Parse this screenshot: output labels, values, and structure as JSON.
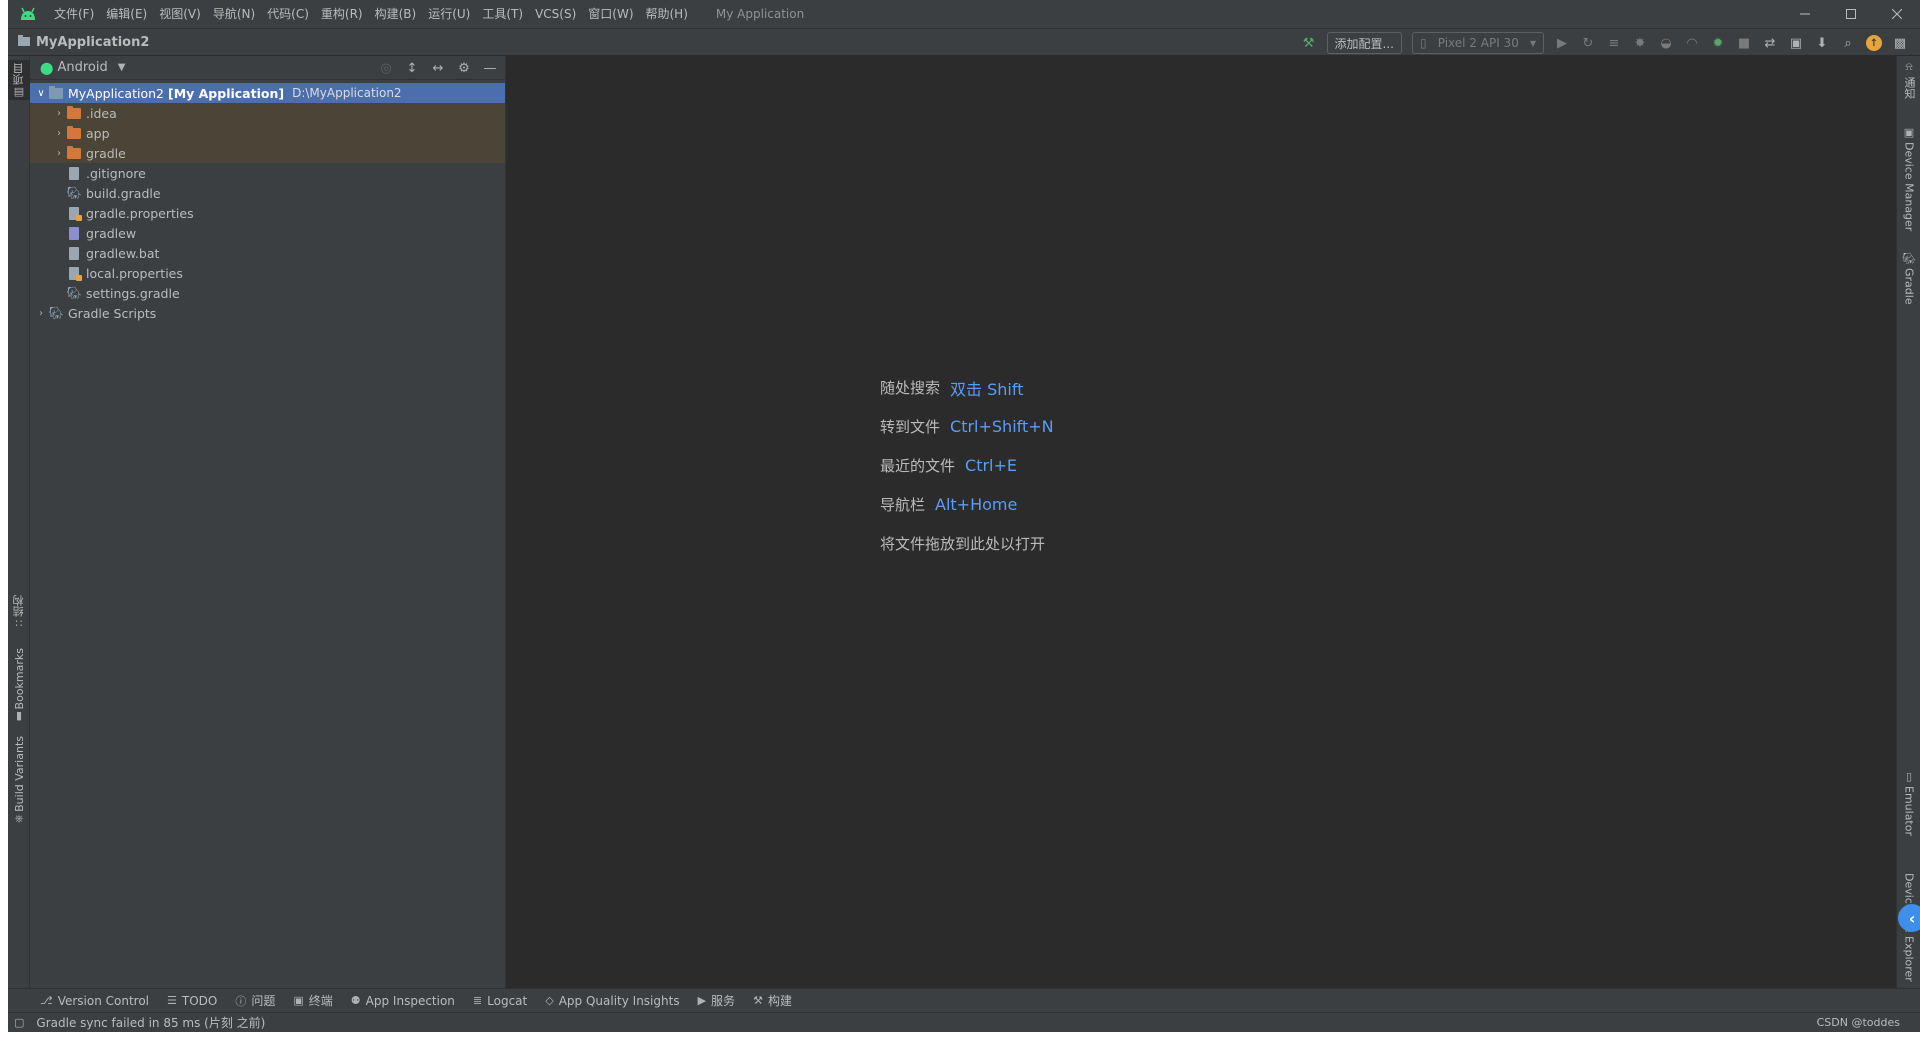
{
  "titlebar": {
    "menus": [
      "文件(F)",
      "编辑(E)",
      "视图(V)",
      "导航(N)",
      "代码(C)",
      "重构(R)",
      "构建(B)",
      "运行(U)",
      "工具(T)",
      "VCS(S)",
      "窗口(W)",
      "帮助(H)"
    ],
    "app_title": "My Application"
  },
  "navbar": {
    "project_name": "MyApplication2",
    "add_config_label": "添加配置...",
    "device_label": "Pixel 2 API 30"
  },
  "left_strip": {
    "project_tab": "项目",
    "structure_tab": "结构",
    "bookmarks_tab": "Bookmarks",
    "build_variants_tab": "Build Variants"
  },
  "right_strip": {
    "notifications_tab": "通知",
    "device_manager_tab": "Device Manager",
    "gradle_tab": "Gradle",
    "emulator_tab": "Emulator",
    "device_file_explorer_tab": "Device File Explorer"
  },
  "project_panel": {
    "view_mode": "Android",
    "root": {
      "name": "MyApplication2",
      "module": "[My Application]",
      "path": "D:\\MyApplication2"
    },
    "items": [
      {
        "label": ".idea"
      },
      {
        "label": "app"
      },
      {
        "label": "gradle"
      },
      {
        "label": ".gitignore"
      },
      {
        "label": "build.gradle"
      },
      {
        "label": "gradle.properties"
      },
      {
        "label": "gradlew"
      },
      {
        "label": "gradlew.bat"
      },
      {
        "label": "local.properties"
      },
      {
        "label": "settings.gradle"
      }
    ],
    "gradle_scripts": "Gradle Scripts"
  },
  "editor": {
    "hints": [
      {
        "label": "随处搜索",
        "key": "双击 Shift"
      },
      {
        "label": "转到文件",
        "key": "Ctrl+Shift+N"
      },
      {
        "label": "最近的文件",
        "key": "Ctrl+E"
      },
      {
        "label": "导航栏",
        "key": "Alt+Home"
      },
      {
        "label": "将文件拖放到此处以打开",
        "key": ""
      }
    ]
  },
  "bottom_bar": {
    "tabs": [
      "Version Control",
      "TODO",
      "问题",
      "终端",
      "App Inspection",
      "Logcat",
      "App Quality Insights",
      "服务",
      "构建"
    ]
  },
  "status_bar": {
    "message": "Gradle sync failed in 85 ms (片刻 之前)",
    "watermark": "CSDN @toddes"
  },
  "colors": {
    "background": "#2b2b2b",
    "panel": "#3c3f41",
    "selection": "#4b6eaf",
    "link_key": "#589df6",
    "folder": "#d4773a",
    "accent_blue": "#3d8fea",
    "android_green": "#3ddc84"
  }
}
